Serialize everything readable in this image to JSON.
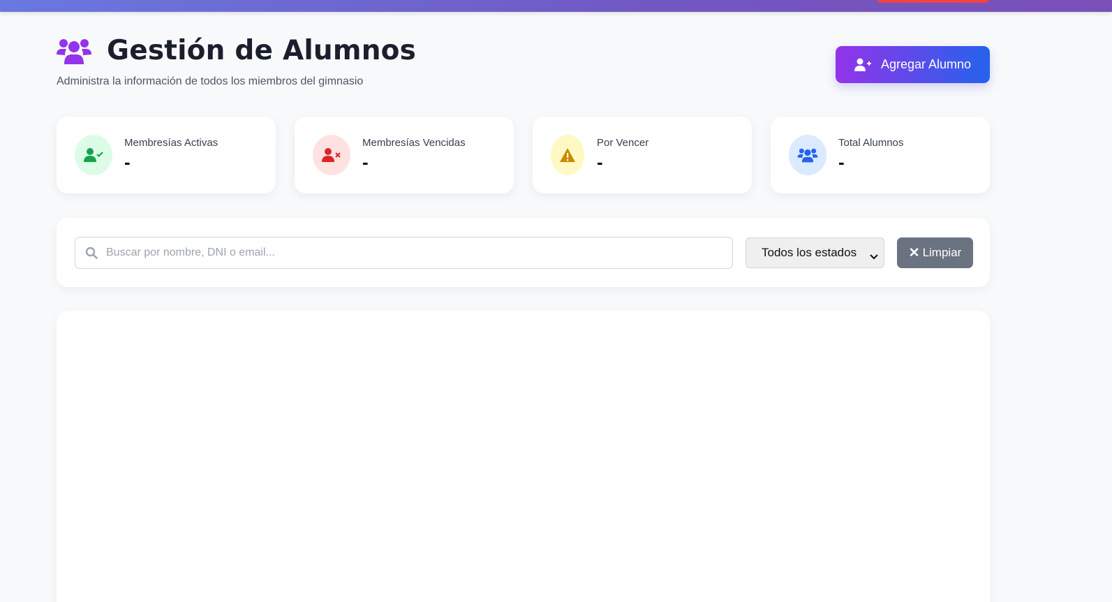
{
  "header": {
    "title": "Gestión de Alumnos",
    "subtitle": "Administra la información de todos los miembros del gimnasio",
    "title_icon": "users-icon",
    "add_button_label": "Agregar Alumno",
    "add_button_icon": "user-plus-icon"
  },
  "stats": [
    {
      "label": "Membresías Activas",
      "value": "-",
      "icon": "user-check-icon",
      "color": "#16a34a",
      "bg": "#dcfce7"
    },
    {
      "label": "Membresías Vencidas",
      "value": "-",
      "icon": "user-x-icon",
      "color": "#dc2626",
      "bg": "#fee2e2"
    },
    {
      "label": "Por Vencer",
      "value": "-",
      "icon": "warning-icon",
      "color": "#ca8a04",
      "bg": "#fef9c3"
    },
    {
      "label": "Total Alumnos",
      "value": "-",
      "icon": "users-icon",
      "color": "#2563eb",
      "bg": "#dbeafe"
    }
  ],
  "filters": {
    "search_placeholder": "Buscar por nombre, DNI o email...",
    "search_value": "",
    "status_selected": "Todos los estados",
    "clear_label": "Limpiar"
  },
  "colors": {
    "accent_start": "#9333ea",
    "accent_end": "#2563eb",
    "title_icon": "#9333ea"
  }
}
